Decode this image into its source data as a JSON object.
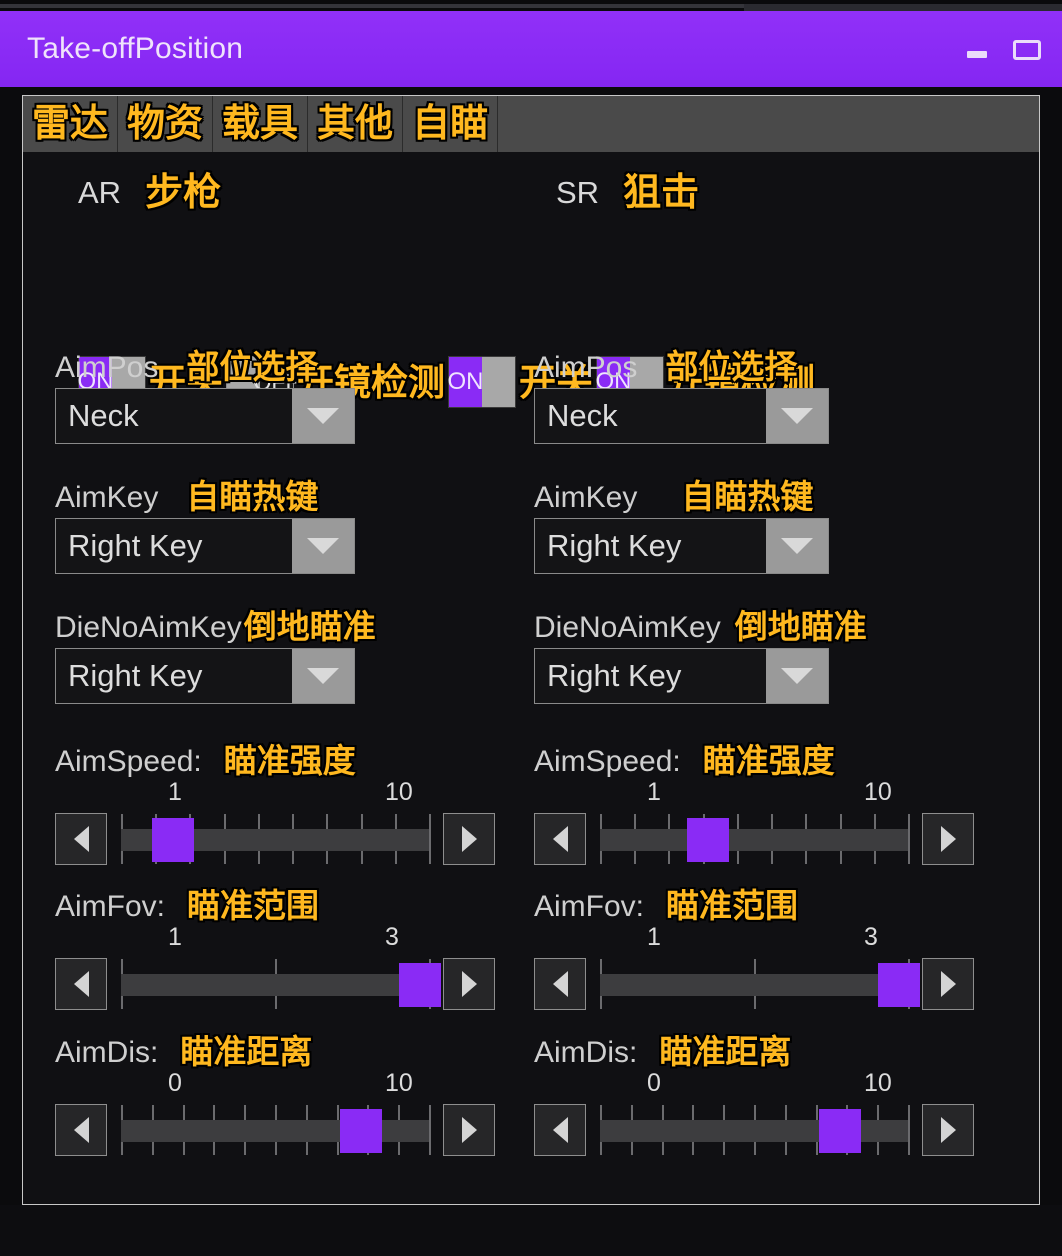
{
  "window": {
    "title": "Take-offPosition",
    "minimize_icon": "minimize-icon",
    "maximize_icon": "maximize-icon",
    "accent_color": "#8a2bf5",
    "panel_bg": "#101013"
  },
  "tabs": [
    {
      "label": "雷达"
    },
    {
      "label": "物资"
    },
    {
      "label": "载具"
    },
    {
      "label": "其他"
    },
    {
      "label": "自瞄"
    }
  ],
  "columns": [
    {
      "id": "ar",
      "code": "AR",
      "code_cn": "步枪",
      "toggles": [
        {
          "state": "ON",
          "label_cn": "开关"
        },
        {
          "state": "OFF",
          "label_cn": "开镜检测"
        }
      ],
      "fields": [
        {
          "name": "AimPos",
          "cn": "部位选择",
          "value": "Neck",
          "arrow_icon": "chevron-down-icon"
        },
        {
          "name": "AimKey",
          "cn": "自瞄热键",
          "value": "Right Key",
          "arrow_icon": "chevron-down-icon"
        },
        {
          "name": "DieNoAimKey",
          "cn": "倒地瞄准",
          "value": "Right Key",
          "arrow_icon": "chevron-down-icon"
        }
      ],
      "sliders": [
        {
          "name": "AimSpeed:",
          "cn": "瞄准强度",
          "min": "1",
          "max": "10",
          "ticks": 10,
          "value_pct": 17
        },
        {
          "name": "AimFov:",
          "cn": "瞄准范围",
          "min": "1",
          "max": "3",
          "ticks": 3,
          "value_pct": 97
        },
        {
          "name": "AimDis:",
          "cn": "瞄准距离",
          "min": "0",
          "max": "10",
          "ticks": 11,
          "value_pct": 78
        }
      ]
    },
    {
      "id": "sr",
      "code": "SR",
      "code_cn": "狙击",
      "toggles": [
        {
          "state": "ON",
          "label_cn": "开关"
        },
        {
          "state": "ON",
          "label_cn": "开镜检测"
        }
      ],
      "fields": [
        {
          "name": "AimPos",
          "cn": "部位选择",
          "value": "Neck",
          "arrow_icon": "chevron-down-icon"
        },
        {
          "name": "AimKey",
          "cn": "自瞄热键",
          "value": "Right Key",
          "arrow_icon": "chevron-down-icon"
        },
        {
          "name": "DieNoAimKey",
          "cn": "倒地瞄准",
          "value": "Right Key",
          "arrow_icon": "chevron-down-icon"
        }
      ],
      "sliders": [
        {
          "name": "AimSpeed:",
          "cn": "瞄准强度",
          "min": "1",
          "max": "10",
          "ticks": 10,
          "value_pct": 35
        },
        {
          "name": "AimFov:",
          "cn": "瞄准范围",
          "min": "1",
          "max": "3",
          "ticks": 3,
          "value_pct": 97
        },
        {
          "name": "AimDis:",
          "cn": "瞄准距离",
          "min": "0",
          "max": "10",
          "ticks": 11,
          "value_pct": 78
        }
      ]
    }
  ],
  "step_icons": {
    "prev": "triangle-left-icon",
    "next": "triangle-right-icon"
  }
}
